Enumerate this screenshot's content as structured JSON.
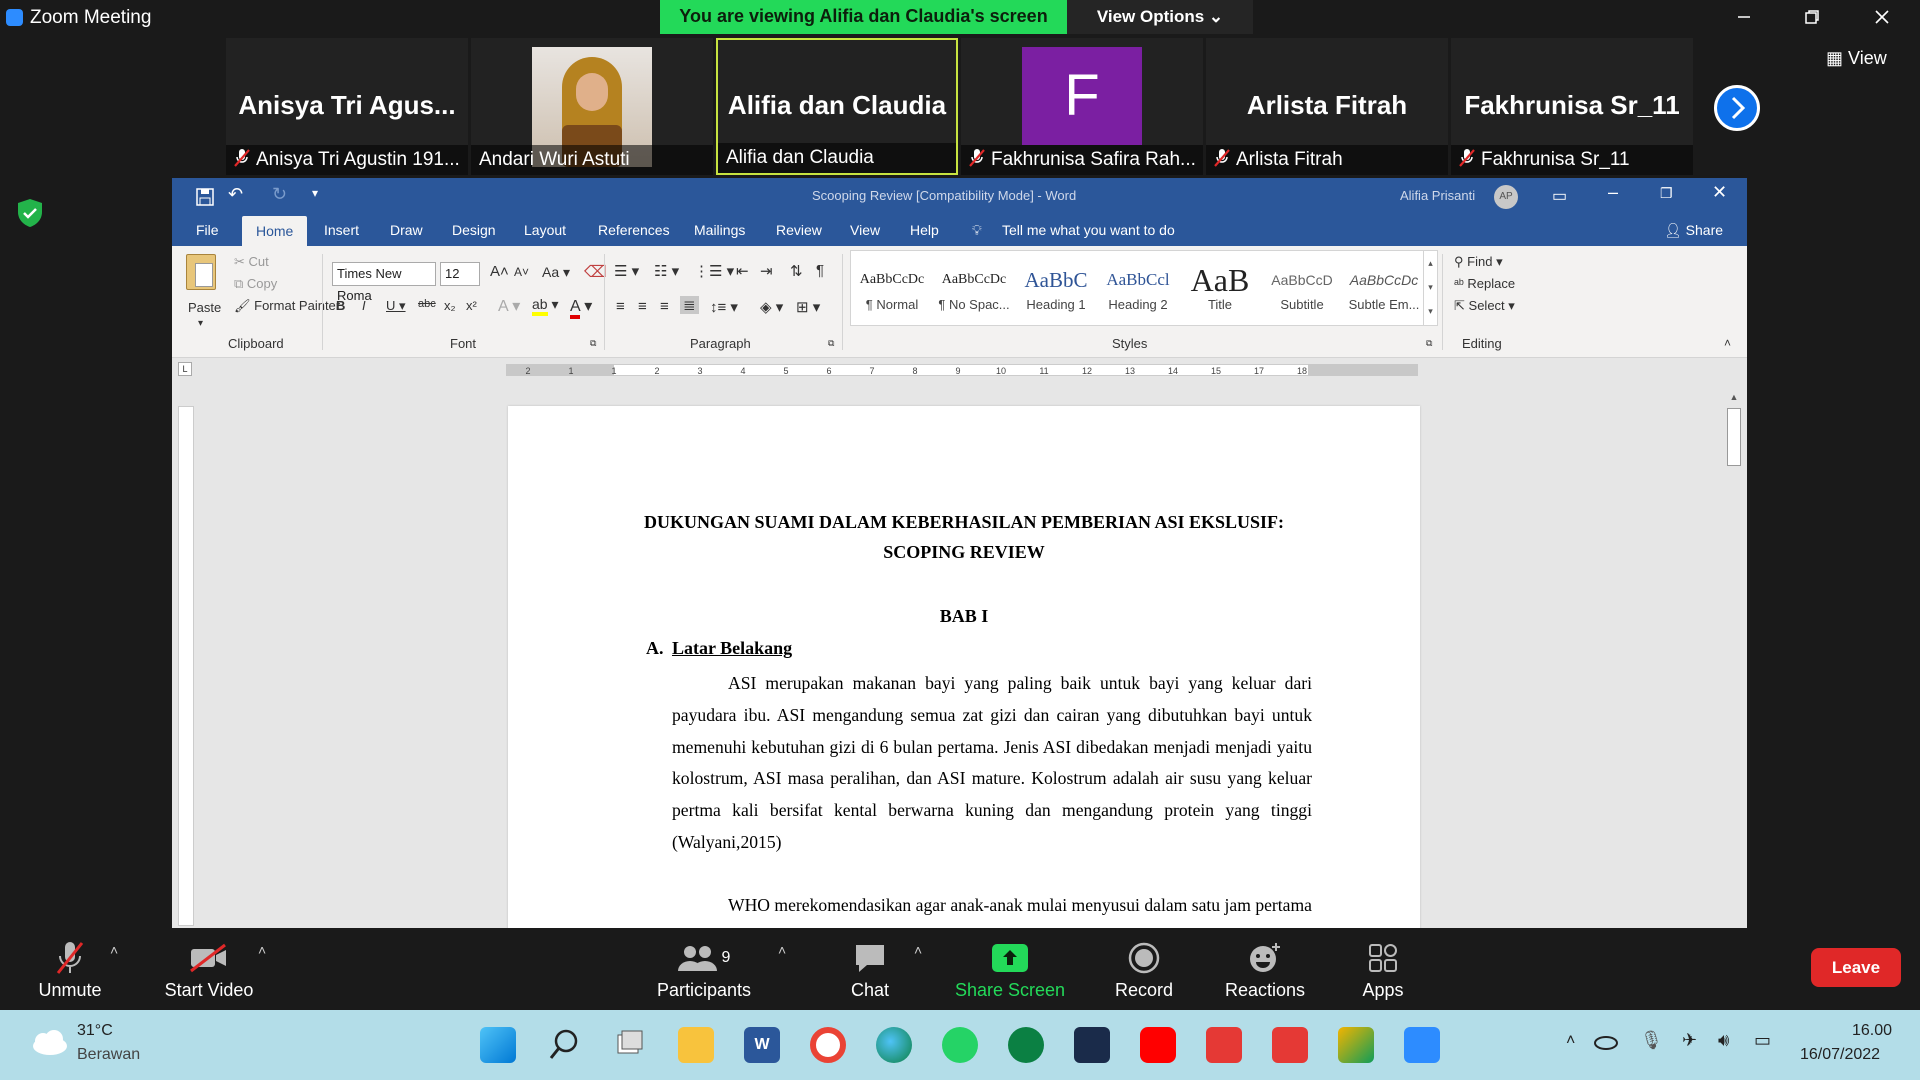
{
  "zoom": {
    "window_title": "Zoom Meeting",
    "banner": "You are viewing Alifia dan Claudia's screen",
    "view_options": "View Options",
    "view_label": "View",
    "participants": [
      {
        "big": "Anisya  Tri  Agus...",
        "label": "Anisya Tri Agustin 191...",
        "muted": true
      },
      {
        "big": "",
        "label": "Andari Wuri Astuti",
        "muted": false
      },
      {
        "big": "Alifia dan Claudia",
        "label": "Alifia dan Claudia",
        "muted": false
      },
      {
        "big": "F",
        "label": "Fakhrunisa Safira Rah...",
        "muted": true
      },
      {
        "big": "Arlista Fitrah",
        "label": "Arlista Fitrah",
        "muted": true
      },
      {
        "big": "Fakhrunisa Sr_11",
        "label": "Fakhrunisa Sr_11",
        "muted": true
      }
    ],
    "toolbar": {
      "unmute": "Unmute",
      "start_video": "Start Video",
      "participants": "Participants",
      "participant_count": "9",
      "chat": "Chat",
      "share_screen": "Share Screen",
      "record": "Record",
      "reactions": "Reactions",
      "apps": "Apps",
      "leave": "Leave"
    },
    "colors": {
      "banner": "#23d959",
      "leave": "#e02828",
      "share": "#23d959",
      "avatar_f": "#7b1fa2"
    }
  },
  "word": {
    "title": "Scooping Review [Compatibility Mode]  -  Word",
    "user": "Alifia Prisanti",
    "user_initials": "AP",
    "share": "Share",
    "tabs": [
      "File",
      "Home",
      "Insert",
      "Draw",
      "Design",
      "Layout",
      "References",
      "Mailings",
      "Review",
      "View",
      "Help"
    ],
    "tell_me": "Tell me what you want to do",
    "clipboard": {
      "paste": "Paste",
      "cut": "Cut",
      "copy": "Copy",
      "format_painter": "Format Painter",
      "group": "Clipboard"
    },
    "font": {
      "name": "Times New Roma",
      "size": "12",
      "group": "Font"
    },
    "paragraph_group": "Paragraph",
    "styles": [
      {
        "preview": "AaBbCcDc",
        "name": "¶ Normal"
      },
      {
        "preview": "AaBbCcDc",
        "name": "¶ No Spac..."
      },
      {
        "preview": "AaBbC",
        "name": "Heading 1"
      },
      {
        "preview": "AaBbCcl",
        "name": "Heading 2"
      },
      {
        "preview": "AaB",
        "name": "Title"
      },
      {
        "preview": "AaBbCcD",
        "name": "Subtitle"
      },
      {
        "preview": "AaBbCcDc",
        "name": "Subtle Em..."
      }
    ],
    "styles_group": "Styles",
    "editing": {
      "find": "Find",
      "replace": "Replace",
      "select": "Select",
      "group": "Editing"
    },
    "ruler_numbers": [
      "2",
      "1",
      "1",
      "2",
      "3",
      "4",
      "5",
      "6",
      "7",
      "8",
      "9",
      "10",
      "11",
      "12",
      "13",
      "14",
      "15",
      "17",
      "18"
    ],
    "document": {
      "title_line1": "DUKUNGAN SUAMI DALAM KEBERHASILAN PEMBERIAN ASI EKSLUSIF:",
      "title_line2": "SCOPING REVIEW",
      "chapter": "BAB I",
      "section_marker": "A.",
      "section_title": "Latar Belakang",
      "para1": "ASI merupakan makanan bayi yang paling baik untuk bayi yang keluar dari payudara ibu. ASI mengandung semua zat gizi dan cairan yang dibutuhkan bayi untuk memenuhi kebutuhan gizi di 6 bulan pertama. Jenis ASI dibedakan menjadi menjadi yaitu kolostrum, ASI masa peralihan, dan ASI mature. Kolostrum adalah air susu yang keluar pertma kali bersifat kental berwarna kuning dan mengandung protein yang tinggi (Walyani,2015)",
      "para2": "WHO merekomendasikan agar anak-anak mulai menyusui dalam satu jam pertama kehidupan, bayi harus disusui sesering mungkin serta pemakaian dot ataupun"
    }
  },
  "taskbar": {
    "temp": "31°C",
    "weather": "Berawan",
    "time": "16.00",
    "date": "16/07/2022"
  }
}
